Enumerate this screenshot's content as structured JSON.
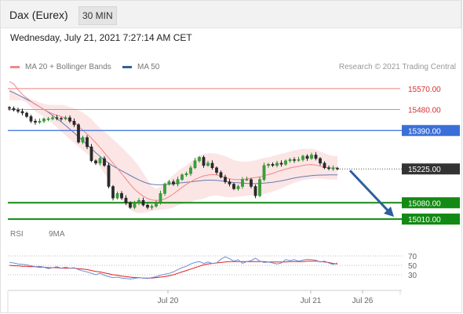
{
  "header": {
    "instrument": "Dax (Eurex)",
    "timeframe": "30 MIN"
  },
  "timestamp": "Wednesday, July 21, 2021 7:27:14 AM CET",
  "legend": {
    "ma20_label": "MA 20 + Bollinger Bands",
    "ma50_label": "MA 50",
    "credit": "Research © 2021 Trading Central"
  },
  "rsi_legend": {
    "rsi_label": "RSI",
    "ma_label": "9MA"
  },
  "colors": {
    "resistance": "#f08080",
    "pivot": "#3a6fd8",
    "support": "#138a13",
    "last": "#333333",
    "candle_up": "#2a8c2a",
    "candle_down": "#222222",
    "ma20": "#f08888",
    "ma50": "#4c6aa8",
    "bollinger": "#fadcdc",
    "arrow": "#2f5f9e",
    "rsi": "#6b8fd6",
    "rsi_ma": "#e02020"
  },
  "chart_data": [
    {
      "type": "candlestick",
      "title": "Dax (Eurex)",
      "timeframe": "30 MIN",
      "ylim": [
        14990,
        15630
      ],
      "x_ticks": [
        "Jul 20",
        "Jul 21",
        "Jul 26"
      ],
      "levels": [
        {
          "label": "15570.00",
          "value": 15570,
          "kind": "resistance"
        },
        {
          "label": "15480.00",
          "value": 15480,
          "kind": "resistance"
        },
        {
          "label": "15390.00",
          "value": 15390,
          "kind": "pivot"
        },
        {
          "label": "15225.00",
          "value": 15225,
          "kind": "last"
        },
        {
          "label": "15080.00",
          "value": 15080,
          "kind": "support"
        },
        {
          "label": "15010.00",
          "value": 15010,
          "kind": "support"
        }
      ],
      "closes": [
        15485,
        15478,
        15472,
        15465,
        15450,
        15430,
        15425,
        15430,
        15440,
        15440,
        15445,
        15442,
        15440,
        15445,
        15430,
        15415,
        15340,
        15360,
        15320,
        15260,
        15250,
        15270,
        15240,
        15150,
        15100,
        15120,
        15100,
        15080,
        15060,
        15080,
        15090,
        15070,
        15060,
        15065,
        15080,
        15120,
        15160,
        15170,
        15160,
        15180,
        15200,
        15205,
        15230,
        15260,
        15275,
        15240,
        15250,
        15230,
        15210,
        15190,
        15170,
        15160,
        15140,
        15150,
        15180,
        15180,
        15150,
        15110,
        15180,
        15240,
        15245,
        15240,
        15250,
        15245,
        15260,
        15265,
        15262,
        15265,
        15280,
        15270,
        15285,
        15270,
        15250,
        15230,
        15227,
        15228,
        15225
      ],
      "ma20": [
        15600,
        15590,
        15565,
        15545,
        15530,
        15515,
        15502,
        15492,
        15480,
        15470,
        15462,
        15455,
        15450,
        15444,
        15436,
        15426,
        15408,
        15392,
        15375,
        15357,
        15337,
        15317,
        15295,
        15272,
        15250,
        15228,
        15205,
        15182,
        15159,
        15138,
        15122,
        15108,
        15098,
        15092,
        15090,
        15091,
        15096,
        15106,
        15118,
        15132,
        15146,
        15159,
        15170,
        15180,
        15188,
        15195,
        15199,
        15201,
        15200,
        15194,
        15188,
        15183,
        15180,
        15179,
        15180,
        15183,
        15186,
        15188,
        15191,
        15196,
        15201,
        15206,
        15213,
        15219,
        15224,
        15229,
        15233,
        15236,
        15240,
        15243,
        15244,
        15242,
        15237,
        15233,
        15230,
        15230,
        15230
      ],
      "ma50": [
        15560,
        15552,
        15543,
        15534,
        15524,
        15514,
        15503,
        15492,
        15480,
        15468,
        15455,
        15441,
        15427,
        15412,
        15396,
        15380,
        15363,
        15346,
        15329,
        15312,
        15295,
        15279,
        15264,
        15250,
        15238,
        15227,
        15217,
        15207,
        15197,
        15187,
        15178,
        15170,
        15163,
        15159,
        15157,
        15157,
        15158,
        15160,
        15162,
        15164,
        15166,
        15168,
        15170,
        15172,
        15174,
        15176,
        15177,
        15177,
        15176,
        15174,
        15171,
        15169,
        15167,
        15166,
        15164,
        15163,
        15162,
        15162,
        15163,
        15164,
        15166,
        15168,
        15171,
        15174,
        15178,
        15182,
        15186,
        15189,
        15192,
        15194,
        15196,
        15198,
        15199,
        15199,
        15200,
        15200,
        15200
      ],
      "bollinger_upper": [
        15570,
        15560,
        15545,
        15535,
        15530,
        15525,
        15518,
        15510,
        15505,
        15500,
        15500,
        15500,
        15500,
        15497,
        15490,
        15485,
        15476,
        15468,
        15454,
        15440,
        15418,
        15400,
        15385,
        15370,
        15352,
        15336,
        15318,
        15300,
        15280,
        15260,
        15236,
        15208,
        15178,
        15152,
        15140,
        15150,
        15165,
        15180,
        15200,
        15215,
        15228,
        15240,
        15255,
        15270,
        15282,
        15290,
        15292,
        15292,
        15290,
        15285,
        15280,
        15272,
        15263,
        15258,
        15256,
        15256,
        15258,
        15262,
        15268,
        15272,
        15275,
        15280,
        15285,
        15290,
        15295,
        15300,
        15305,
        15308,
        15312,
        15310,
        15312,
        15308,
        15300,
        15292,
        15285,
        15280,
        15280
      ],
      "bollinger_lower": [
        15520,
        15520,
        15520,
        15520,
        15510,
        15490,
        15472,
        15460,
        15450,
        15436,
        15420,
        15404,
        15385,
        15370,
        15352,
        15338,
        15320,
        15305,
        15290,
        15274,
        15254,
        15234,
        15206,
        15180,
        15148,
        15120,
        15095,
        15068,
        15050,
        15040,
        15035,
        15037,
        15040,
        15045,
        15048,
        15050,
        15052,
        15055,
        15060,
        15068,
        15075,
        15080,
        15084,
        15090,
        15094,
        15098,
        15105,
        15110,
        15112,
        15108,
        15105,
        15104,
        15104,
        15106,
        15108,
        15110,
        15112,
        15114,
        15114,
        15118,
        15122,
        15128,
        15134,
        15142,
        15150,
        15158,
        15166,
        15172,
        15177,
        15180,
        15182,
        15184,
        15183,
        15182,
        15180,
        15180,
        15180
      ]
    },
    {
      "type": "line",
      "title": "RSI",
      "ylim": [
        0,
        100
      ],
      "y_ticks": [
        70,
        50,
        30
      ],
      "x_ticks": [
        "Jul 20",
        "Jul 21",
        "Jul 26"
      ],
      "series": [
        {
          "name": "RSI",
          "values": [
            56,
            55,
            53,
            52,
            51,
            49,
            47,
            48,
            46,
            43,
            45,
            47,
            44,
            46,
            44,
            45,
            41,
            38,
            36,
            33,
            30,
            33,
            29,
            26,
            24,
            25,
            23,
            22,
            21,
            22,
            24,
            23,
            22,
            24,
            26,
            29,
            31,
            33,
            36,
            41,
            45,
            48,
            53,
            56,
            58,
            54,
            57,
            54,
            55,
            63,
            68,
            64,
            59,
            62,
            54,
            58,
            60,
            65,
            59,
            56,
            57,
            55,
            53,
            55,
            62,
            60,
            62,
            59,
            61,
            63,
            62,
            61,
            57,
            59,
            55,
            52,
            55
          ]
        },
        {
          "name": "9MA",
          "values": [
            50,
            49,
            49,
            48,
            48,
            47,
            47,
            46,
            46,
            45,
            45,
            45,
            44,
            44,
            44,
            44,
            43,
            42,
            41,
            39,
            37,
            36,
            34,
            32,
            30,
            29,
            27,
            26,
            25,
            24,
            24,
            23,
            23,
            23,
            24,
            25,
            26,
            28,
            30,
            33,
            36,
            39,
            42,
            45,
            48,
            51,
            53,
            54,
            55,
            56,
            57,
            58,
            58,
            58,
            58,
            58,
            58,
            58,
            58,
            58,
            57,
            57,
            57,
            57,
            57,
            58,
            58,
            58,
            58,
            59,
            59,
            59,
            58,
            57,
            56,
            54,
            53
          ]
        }
      ]
    }
  ]
}
